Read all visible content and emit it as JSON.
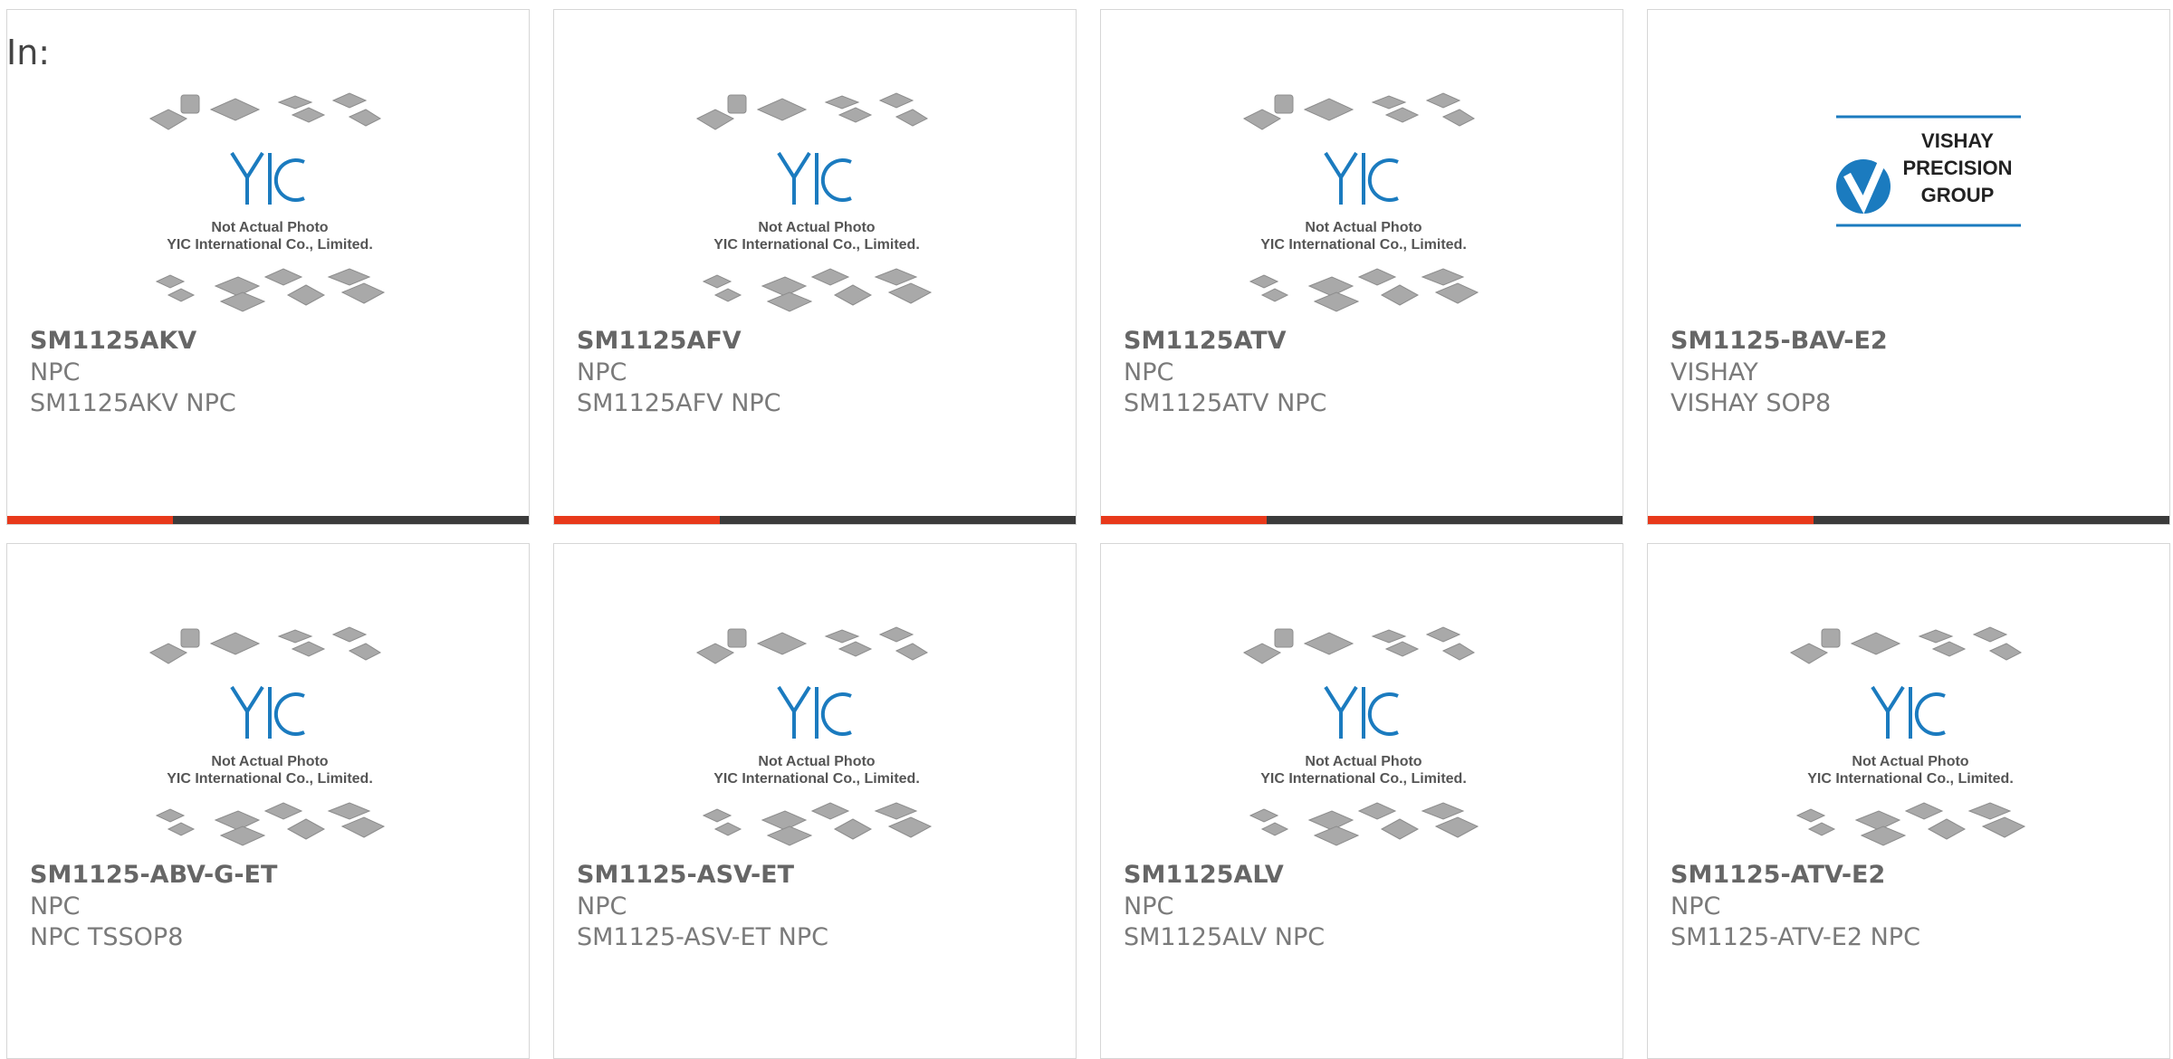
{
  "header": {
    "in_label": "In:"
  },
  "placeholder_text": {
    "line1": "Not Actual Photo",
    "line2": "YIC International Co., Limited.",
    "logo": "YIC"
  },
  "vishay_logo": {
    "line1": "VISHAY",
    "line2": "PRECISION",
    "line3": "GROUP"
  },
  "colors": {
    "accent": "#e8391b",
    "bar": "#3b3b3b",
    "logo_blue": "#1b7bbf"
  },
  "products": [
    {
      "part": "SM1125AKV",
      "manufacturer": "NPC",
      "description": "SM1125AKV NPC",
      "image": "yic-placeholder"
    },
    {
      "part": "SM1125AFV",
      "manufacturer": "NPC",
      "description": "SM1125AFV NPC",
      "image": "yic-placeholder"
    },
    {
      "part": "SM1125ATV",
      "manufacturer": "NPC",
      "description": "SM1125ATV NPC",
      "image": "yic-placeholder"
    },
    {
      "part": "SM1125-BAV-E2",
      "manufacturer": "VISHAY",
      "description": "VISHAY SOP8",
      "image": "vishay-logo"
    },
    {
      "part": "SM1125-ABV-G-ET",
      "manufacturer": "NPC",
      "description": "NPC TSSOP8",
      "image": "yic-placeholder"
    },
    {
      "part": "SM1125-ASV-ET",
      "manufacturer": "NPC",
      "description": "SM1125-ASV-ET NPC",
      "image": "yic-placeholder"
    },
    {
      "part": "SM1125ALV",
      "manufacturer": "NPC",
      "description": "SM1125ALV NPC",
      "image": "yic-placeholder"
    },
    {
      "part": "SM1125-ATV-E2",
      "manufacturer": "NPC",
      "description": "SM1125-ATV-E2 NPC",
      "image": "yic-placeholder"
    }
  ]
}
